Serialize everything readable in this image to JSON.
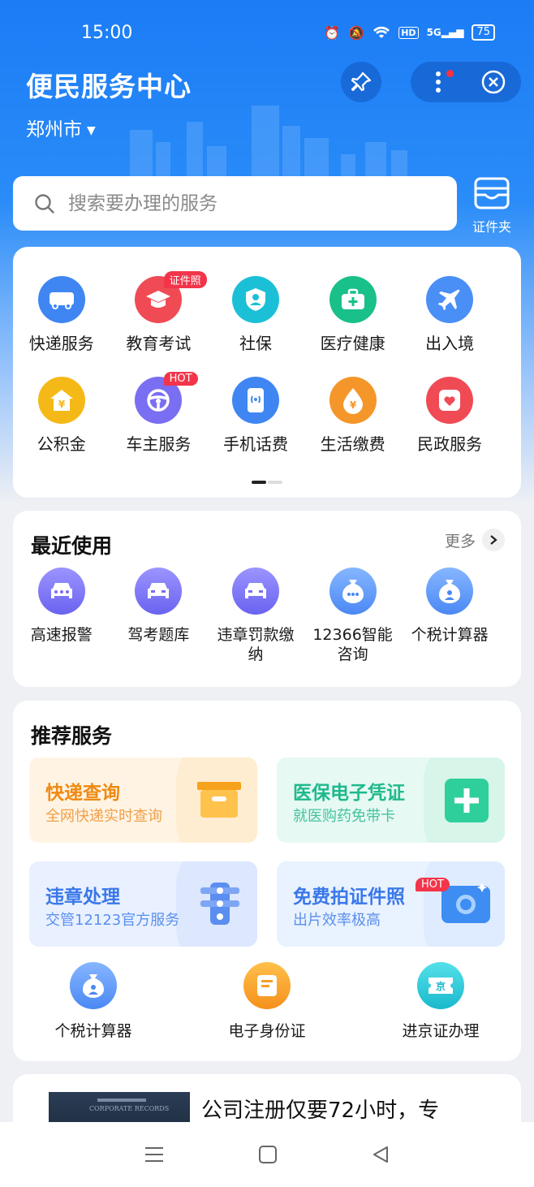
{
  "status_bar": {
    "time": "15:00",
    "network": "5G",
    "hd": "HD",
    "battery": "75"
  },
  "header": {
    "title": "便民服务中心",
    "city": "郑州市",
    "wallet_label": "证件夹"
  },
  "search": {
    "placeholder": "搜索要办理的服务"
  },
  "services": [
    {
      "label": "快递服务",
      "icon": "truck-icon",
      "color": "#3f86f3"
    },
    {
      "label": "教育考试",
      "icon": "graduation-cap-icon",
      "color": "#f04b55",
      "badge": "证件照"
    },
    {
      "label": "社保",
      "icon": "shield-person-icon",
      "color": "#1cc0d6"
    },
    {
      "label": "医疗健康",
      "icon": "medical-kit-icon",
      "color": "#19c08a"
    },
    {
      "label": "出入境",
      "icon": "airplane-icon",
      "color": "#4a8ff6"
    },
    {
      "label": "公积金",
      "icon": "house-yuan-icon",
      "color": "#f5b917"
    },
    {
      "label": "车主服务",
      "icon": "steering-wheel-icon",
      "color": "#7a6ef2",
      "badge": "HOT"
    },
    {
      "label": "手机话费",
      "icon": "phone-icon",
      "color": "#3f86f3"
    },
    {
      "label": "生活缴费",
      "icon": "drop-yuan-icon",
      "color": "#f5962a"
    },
    {
      "label": "民政服务",
      "icon": "heart-card-icon",
      "color": "#f04b55"
    }
  ],
  "recent": {
    "title": "最近使用",
    "more": "更多",
    "items": [
      {
        "label": "高速报警",
        "icon": "car-icon"
      },
      {
        "label": "驾考题库",
        "icon": "car-icon"
      },
      {
        "label": "违章罚款缴纳",
        "icon": "car-icon"
      },
      {
        "label": "12366智能咨询",
        "icon": "chat-bag-icon"
      },
      {
        "label": "个税计算器",
        "icon": "money-bag-icon"
      }
    ]
  },
  "recommend": {
    "title": "推荐服务",
    "tiles": [
      {
        "title": "快递查询",
        "subtitle": "全网快递实时查询",
        "icon": "parcel-box-icon"
      },
      {
        "title": "医保电子凭证",
        "subtitle": "就医购药免带卡",
        "icon": "medical-cross-icon"
      },
      {
        "title": "违章处理",
        "subtitle": "交管12123官方服务",
        "icon": "traffic-light-icon"
      },
      {
        "title": "免费拍证件照",
        "subtitle": "出片效率极高",
        "icon": "camera-icon",
        "badge": "HOT"
      }
    ],
    "items": [
      {
        "label": "个税计算器",
        "icon": "money-bag-icon"
      },
      {
        "label": "电子身份证",
        "icon": "id-card-icon"
      },
      {
        "label": "进京证办理",
        "icon": "jing-ticket-icon"
      }
    ]
  },
  "ad": {
    "text": "公司注册仅要72小时，专",
    "image_text": "CORPORATE RECORDS"
  }
}
